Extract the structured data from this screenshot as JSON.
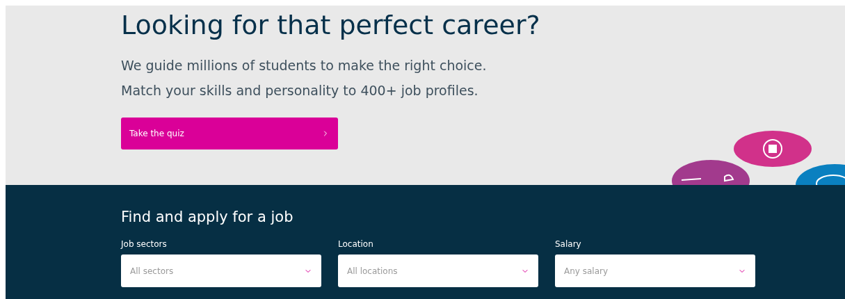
{
  "hero": {
    "title": "Looking for that perfect career?",
    "lines": [
      "We guide millions of students to make the right choice.",
      "Match your skills and personality to 400+ job profiles."
    ],
    "button": "Take the quiz"
  },
  "search": {
    "title": "Find and apply for a job",
    "fields": [
      {
        "label": "Job sectors",
        "placeholder": "All sectors"
      },
      {
        "label": "Location",
        "placeholder": "All locations"
      },
      {
        "label": "Salary",
        "placeholder": "Any salary"
      }
    ]
  }
}
